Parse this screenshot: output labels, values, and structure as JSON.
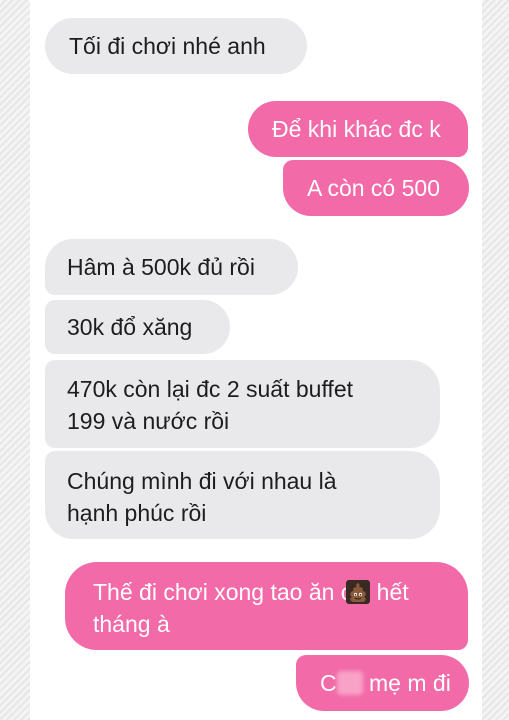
{
  "messages": [
    {
      "id": "m1",
      "direction": "incoming",
      "text": "Tối đi chơi nhé anh"
    },
    {
      "id": "m2",
      "direction": "outgoing",
      "text": "Để khi khác đc k"
    },
    {
      "id": "m3",
      "direction": "outgoing",
      "text": "A còn có 500"
    },
    {
      "id": "m4",
      "direction": "incoming",
      "text": "Hâm à 500k đủ rồi"
    },
    {
      "id": "m5",
      "direction": "incoming",
      "text": "30k đổ xăng"
    },
    {
      "id": "m6",
      "direction": "incoming",
      "line1": "470k còn lại đc 2 suất buffet",
      "line2": "199 và nước rồi"
    },
    {
      "id": "m7",
      "direction": "incoming",
      "line1": "Chúng mình đi với nhau là",
      "line2": "hạnh phúc rồi"
    },
    {
      "id": "m8",
      "direction": "outgoing",
      "part1": "Thế đi chơi xong tao ăn c",
      "emoji": "pile-of-poo-icon",
      "part2": " hết",
      "line2": "tháng à"
    },
    {
      "id": "m9",
      "direction": "outgoing",
      "part1": "C",
      "part2": " mẹ m đi"
    }
  ],
  "colors": {
    "incoming_bubble": "#e9e9ec",
    "outgoing_bubble": "#f26aa8",
    "incoming_text": "#1d1d1f",
    "outgoing_text": "#ffffff"
  }
}
